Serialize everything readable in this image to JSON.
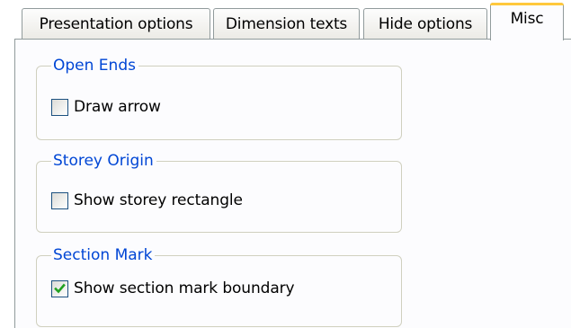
{
  "tabs": [
    {
      "label": "Presentation options",
      "active": false
    },
    {
      "label": "Dimension texts",
      "active": false
    },
    {
      "label": "Hide options",
      "active": false
    },
    {
      "label": "Misc",
      "active": true
    }
  ],
  "groups": [
    {
      "title": "Open Ends",
      "option": {
        "label": "Draw arrow",
        "checked": false
      }
    },
    {
      "title": "Storey Origin",
      "option": {
        "label": "Show storey rectangle",
        "checked": false
      }
    },
    {
      "title": "Section Mark",
      "option": {
        "label": "Show section mark boundary",
        "checked": true
      }
    }
  ],
  "colors": {
    "group_title": "#0046d5",
    "active_tab_highlight": "#ffc83c",
    "checkmark": "#21a121"
  },
  "icons": {
    "checkmark": "checkmark-icon"
  }
}
